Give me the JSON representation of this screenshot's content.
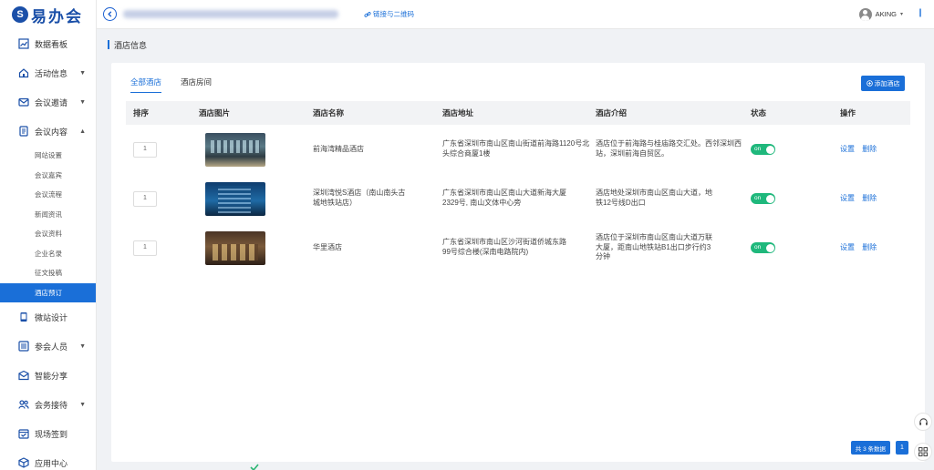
{
  "app": {
    "logo_text": "易办会"
  },
  "topbar": {
    "link_label": "链接与二维码",
    "user_name": "AKING"
  },
  "sidebar": {
    "items": [
      {
        "label": "数据看板",
        "icon": "chart-icon",
        "caret": false
      },
      {
        "label": "活动信息",
        "icon": "home-icon",
        "caret": true
      },
      {
        "label": "会议邀请",
        "icon": "mail-icon",
        "caret": true
      },
      {
        "label": "会议内容",
        "icon": "document-icon",
        "caret": true,
        "expanded": true
      },
      {
        "label": "微站设计",
        "icon": "mobile-icon",
        "caret": false
      },
      {
        "label": "参会人员",
        "icon": "list-icon",
        "caret": true
      },
      {
        "label": "智能分享",
        "icon": "envelope-icon",
        "caret": false
      },
      {
        "label": "会务接待",
        "icon": "people-icon",
        "caret": true
      },
      {
        "label": "现场签到",
        "icon": "calendar-icon",
        "caret": false
      },
      {
        "label": "应用中心",
        "icon": "cube-icon",
        "caret": false
      }
    ],
    "sub_items": [
      "网站设置",
      "会议嘉宾",
      "会议流程",
      "新闻资讯",
      "会议资料",
      "企业名录",
      "征文投稿",
      "酒店预订"
    ],
    "active_sub": "酒店预订"
  },
  "page": {
    "title": "酒店信息"
  },
  "tabs": [
    "全部酒店",
    "酒店房间"
  ],
  "active_tab": "全部酒店",
  "add_button": "添加酒店",
  "table": {
    "headers": [
      "排序",
      "酒店图片",
      "酒店名称",
      "酒店地址",
      "酒店介绍",
      "状态",
      "操作"
    ],
    "rows": [
      {
        "sort": "1",
        "name": "前海湾精品酒店",
        "address": "广东省深圳市南山区南山街道前海路1120号北头综合商厦1楼",
        "intro": "酒店位于前海路与桂庙路交汇处。西邻深圳西站，深圳前海自贸区。",
        "status": "on",
        "actions": [
          "设置",
          "删除"
        ]
      },
      {
        "sort": "1",
        "name": "深圳湾悦S酒店（南山南头古城地铁站店）",
        "address": "广东省深圳市南山区南山大道新海大厦2329号, 南山文体中心旁",
        "intro": "酒店地处深圳市南山区南山大道，地铁12号线D出口",
        "status": "on",
        "actions": [
          "设置",
          "删除"
        ]
      },
      {
        "sort": "1",
        "name": "华里酒店",
        "address": "广东省深圳市南山区沙河街道侨城东路99号综合楼(深南电路院内)",
        "intro": "酒店位于深圳市南山区南山大道万联大厦，距南山地铁站B1出口步行约3分钟",
        "status": "on",
        "actions": [
          "设置",
          "删除"
        ]
      }
    ]
  },
  "pagination": {
    "total_label": "共 3 条数据",
    "current_page": "1"
  },
  "colors": {
    "primary": "#1a6fd8",
    "toggle_on": "#1fb87c",
    "logo": "#1a4fa8"
  }
}
